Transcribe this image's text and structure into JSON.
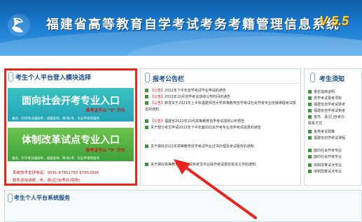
{
  "header": {
    "title": "福建省高等教育自学考试考务考籍管理信息系统",
    "version": "V 5.5"
  },
  "left_panel": {
    "title": "考生个人平台登入模块选择",
    "entries": [
      {
        "label": "面向社会开考专业入口",
        "note": "准考证号以 \"0\" 开头",
        "footer": "报名、打印考试通知单、成绩查询、转(免)考、毕业申请等服务"
      },
      {
        "label": "体制改革试点专业入口",
        "note": "准考证号以 \"9\" 开头",
        "footer": "报名、打印考试通知单、成绩查询、转(免)考、毕业申请等服务"
      }
    ],
    "support": {
      "line1": "系统技术支持电话：0591-87852785  87851896",
      "line2": "联系咨询请拨、市、县(区)自考办(院校)"
    }
  },
  "bulletin": {
    "title": "报考公告栏",
    "items": [
      {
        "tag": "【公告】",
        "text": "2022年下半年自学考试毕业申请的通告"
      },
      {
        "tag": "【公告】",
        "text": "2022年10月自学考试成绩公布时间的通告"
      },
      {
        "tag": "【公告】",
        "text": "转发关于2023年上半年福建师范大学高等教育自学考试社会开考专业衔接课程考试报名的通知"
      },
      {
        "tag": "【公告】",
        "text": "福建省2022年10月高等教育自学考试成绩公布预告"
      },
      {
        "tag": "",
        "text": "关于部分考生申请2022年下半年面向社会开考专业自学考试退费的通告"
      },
      {
        "tag": "",
        "text": "关于做好2022年高等教育自学考试毕业证书办理及考试服务的通知"
      },
      {
        "tag": "",
        "text": "关于做好高等教育自学考试新考生专业操作考试报名有关工作的通知"
      }
    ]
  },
  "exam_notice": {
    "title": "考生须知",
    "items": [
      "报名指南说明",
      "自学考试报考须知",
      "福建省自学考试转考",
      "福建省自学考试免考",
      "各市、县(区)自考办",
      "联系方式",
      "各类考试政策",
      "福建省自学考试课程",
      "面向社会开考专业",
      "面向社会开考专业",
      "体制改革试点专业",
      "体制改革试点专业"
    ]
  },
  "bottom": {
    "title": "考生个人平台系统服务"
  },
  "colors": {
    "header_blue": "#1a7bd0",
    "highlight_red": "#e8241c",
    "social_entry": "#23a4b8",
    "reform_entry": "#3da33c",
    "version_yellow": "#ffd23a"
  }
}
